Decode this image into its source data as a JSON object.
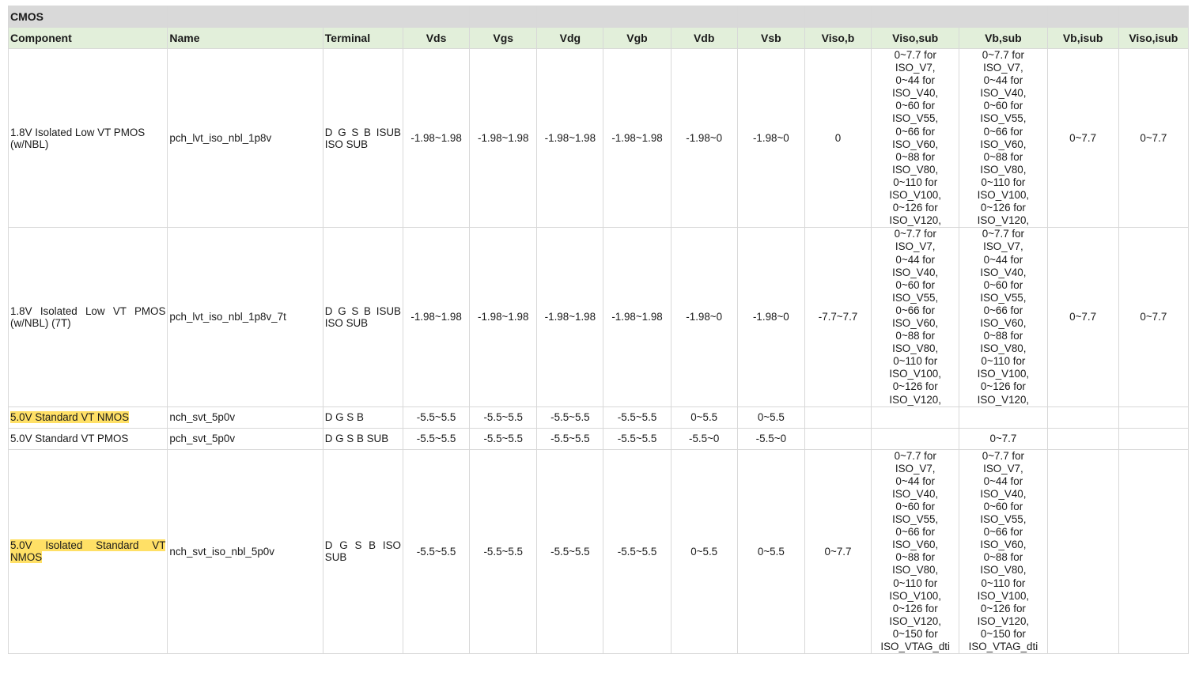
{
  "title": "CMOS",
  "columns": [
    "Component",
    "Name",
    "Terminal",
    "Vds",
    "Vgs",
    "Vdg",
    "Vgb",
    "Vdb",
    "Vsb",
    "Viso,b",
    "Viso,sub",
    "Vb,sub",
    "Vb,isub",
    "Viso,isub"
  ],
  "iso_text_8": "0~7.7 for\nISO_V7,\n0~44 for\nISO_V40,\n0~60 for\nISO_V55,\n0~66 for\nISO_V60,\n0~88 for\nISO_V80,\n0~110 for\nISO_V100,\n0~126 for\nISO_V120,",
  "iso_text_9": "0~7.7 for\nISO_V7,\n0~44 for\nISO_V40,\n0~60 for\nISO_V55,\n0~66 for\nISO_V60,\n0~88 for\nISO_V80,\n0~110 for\nISO_V100,\n0~126 for\nISO_V120,\n0~150 for\nISO_VTAG_dti",
  "rows": [
    {
      "component": "1.8V Isolated Low VT PMOS (w/NBL)",
      "name": "pch_lvt_iso_nbl_1p8v",
      "terminal": "D G S B ISUB ISO SUB",
      "vds": "-1.98~1.98",
      "vgs": "-1.98~1.98",
      "vdg": "-1.98~1.98",
      "vgb": "-1.98~1.98",
      "vdb": "-1.98~0",
      "vsb": "-1.98~0",
      "viso_b": "0",
      "vb_isub": "0~7.7",
      "viso_isub": "0~7.7"
    },
    {
      "component": "1.8V Isolated Low VT PMOS (w/NBL) (7T)",
      "name": "pch_lvt_iso_nbl_1p8v_7t",
      "terminal": "D G S B ISUB ISO SUB",
      "vds": "-1.98~1.98",
      "vgs": "-1.98~1.98",
      "vdg": "-1.98~1.98",
      "vgb": "-1.98~1.98",
      "vdb": "-1.98~0",
      "vsb": "-1.98~0",
      "viso_b": "-7.7~7.7",
      "vb_isub": "0~7.7",
      "viso_isub": "0~7.7"
    },
    {
      "component": "5.0V Standard VT NMOS",
      "name": "nch_svt_5p0v",
      "terminal": "D G S B",
      "vds": "-5.5~5.5",
      "vgs": "-5.5~5.5",
      "vdg": "-5.5~5.5",
      "vgb": "-5.5~5.5",
      "vdb": "0~5.5",
      "vsb": "0~5.5",
      "viso_b": "",
      "viso_sub": "",
      "vb_sub": "",
      "vb_isub": "",
      "viso_isub": "",
      "highlight": true
    },
    {
      "component": "5.0V Standard VT PMOS",
      "name": "pch_svt_5p0v",
      "terminal": "D G S B SUB",
      "vds": "-5.5~5.5",
      "vgs": "-5.5~5.5",
      "vdg": "-5.5~5.5",
      "vgb": "-5.5~5.5",
      "vdb": "-5.5~0",
      "vsb": "-5.5~0",
      "viso_b": "",
      "viso_sub": "",
      "vb_sub": "0~7.7",
      "vb_isub": "",
      "viso_isub": ""
    },
    {
      "component": "5.0V Isolated Standard VT NMOS",
      "name": "nch_svt_iso_nbl_5p0v",
      "terminal": "D G S B ISO SUB",
      "vds": "-5.5~5.5",
      "vgs": "-5.5~5.5",
      "vdg": "-5.5~5.5",
      "vgb": "-5.5~5.5",
      "vdb": "0~5.5",
      "vsb": "0~5.5",
      "viso_b": "0~7.7",
      "vb_isub": "",
      "viso_isub": "",
      "highlight": true
    }
  ]
}
